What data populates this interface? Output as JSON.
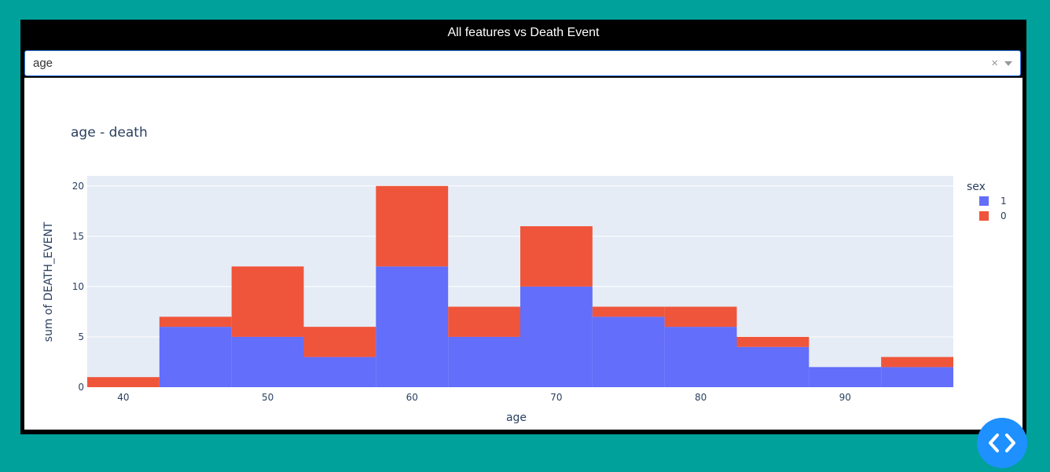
{
  "app": {
    "title": "All features vs Death Event"
  },
  "dropdown": {
    "selected": "age",
    "clear_symbol": "×"
  },
  "colors": {
    "sex_1": "#636efa",
    "sex_0": "#ef553b",
    "plot_bg": "#e5ecf6",
    "page_bg": "#00a19a",
    "fab": "#1e90ff"
  },
  "chart_data": {
    "type": "bar",
    "title": "age - death",
    "xlabel": "age",
    "ylabel": "sum of DEATH_EVENT",
    "xlim": [
      37.5,
      97.5
    ],
    "ylim": [
      0,
      21
    ],
    "xticks": [
      40,
      50,
      60,
      70,
      80,
      90
    ],
    "yticks": [
      0,
      5,
      10,
      15,
      20
    ],
    "bin_width": 5,
    "bins": [
      40,
      45,
      50,
      55,
      60,
      65,
      70,
      75,
      80,
      85,
      90,
      95
    ],
    "legend_title": "sex",
    "legend_position": "right",
    "grid": true,
    "series": [
      {
        "name": "1",
        "color": "#636efa",
        "values": [
          0,
          6,
          5,
          3,
          12,
          5,
          10,
          7,
          6,
          4,
          2,
          2
        ]
      },
      {
        "name": "0",
        "color": "#ef553b",
        "values": [
          1,
          1,
          7,
          3,
          8,
          3,
          6,
          1,
          2,
          1,
          0,
          1
        ]
      }
    ]
  }
}
